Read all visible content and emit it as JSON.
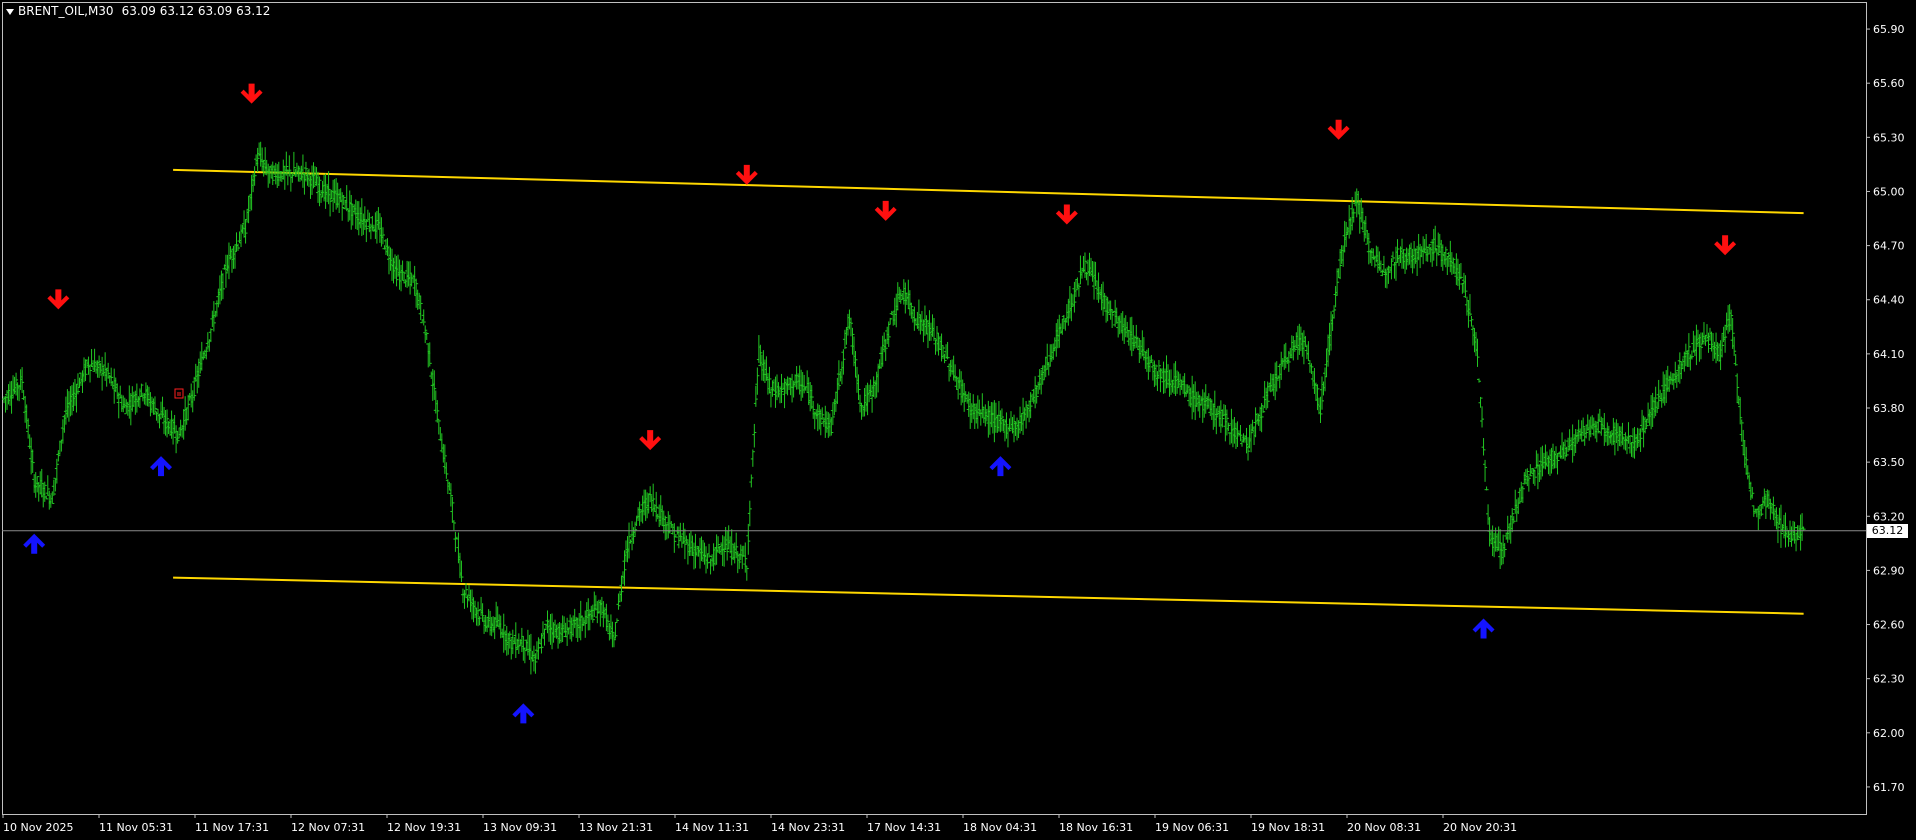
{
  "header": {
    "symbol": "BRENT_OIL,M30",
    "ohlc": "63.09 63.12 63.09 63.12"
  },
  "current_price_label": "63.12",
  "colors": {
    "background": "#000000",
    "frame": "#c0c0c0",
    "bars": "#22c522",
    "channel": "#ffd700",
    "signal_down": "#ff1010",
    "signal_up": "#1414ff",
    "price_line": "#8a8a8a",
    "text": "#ffffff"
  },
  "icons": {
    "dropdown": "triangle-down-icon",
    "sell_signal": "arrow-down-icon",
    "buy_signal": "arrow-up-icon",
    "object_marker": "small-square-icon"
  },
  "chart_data": {
    "type": "ohlc",
    "symbol": "BRENT_OIL",
    "timeframe": "M30",
    "ylim": [
      61.55,
      66.05
    ],
    "y_ticks": [
      "65.90",
      "65.60",
      "65.30",
      "65.00",
      "64.70",
      "64.40",
      "64.10",
      "63.80",
      "63.50",
      "63.20",
      "62.90",
      "62.60",
      "62.30",
      "62.00",
      "61.70"
    ],
    "x_ticks": [
      "10 Nov 2025",
      "11 Nov 05:31",
      "11 Nov 17:31",
      "12 Nov 07:31",
      "12 Nov 19:31",
      "13 Nov 09:31",
      "13 Nov 21:31",
      "14 Nov 11:31",
      "14 Nov 23:31",
      "17 Nov 14:31",
      "18 Nov 04:31",
      "18 Nov 16:31",
      "19 Nov 06:31",
      "19 Nov 18:31",
      "20 Nov 08:31",
      "20 Nov 20:31"
    ],
    "x_span_bars": 308,
    "current_price": 63.12,
    "price_path": [
      [
        0,
        63.85
      ],
      [
        3,
        63.95
      ],
      [
        5,
        63.4
      ],
      [
        8,
        63.3
      ],
      [
        10,
        63.75
      ],
      [
        14,
        64.05
      ],
      [
        17,
        64.0
      ],
      [
        20,
        63.8
      ],
      [
        23,
        63.9
      ],
      [
        26,
        63.75
      ],
      [
        29,
        63.65
      ],
      [
        31,
        63.85
      ],
      [
        34,
        64.2
      ],
      [
        37,
        64.6
      ],
      [
        40,
        64.8
      ],
      [
        42,
        65.2
      ],
      [
        44,
        65.1
      ],
      [
        47,
        65.1
      ],
      [
        50,
        65.1
      ],
      [
        53,
        65.0
      ],
      [
        56,
        64.95
      ],
      [
        59,
        64.85
      ],
      [
        62,
        64.8
      ],
      [
        65,
        64.55
      ],
      [
        68,
        64.5
      ],
      [
        70,
        64.2
      ],
      [
        72,
        63.7
      ],
      [
        74,
        63.3
      ],
      [
        76,
        62.8
      ],
      [
        78,
        62.7
      ],
      [
        80,
        62.6
      ],
      [
        82,
        62.6
      ],
      [
        84,
        62.5
      ],
      [
        86,
        62.5
      ],
      [
        88,
        62.4
      ],
      [
        90,
        62.6
      ],
      [
        92,
        62.55
      ],
      [
        95,
        62.6
      ],
      [
        97,
        62.65
      ],
      [
        99,
        62.7
      ],
      [
        101,
        62.5
      ],
      [
        103,
        63.0
      ],
      [
        105,
        63.2
      ],
      [
        107,
        63.3
      ],
      [
        109,
        63.2
      ],
      [
        111,
        63.1
      ],
      [
        113,
        63.05
      ],
      [
        115,
        63.0
      ],
      [
        117,
        62.95
      ],
      [
        119,
        63.05
      ],
      [
        121,
        63.0
      ],
      [
        123,
        62.95
      ],
      [
        125,
        64.1
      ],
      [
        127,
        63.9
      ],
      [
        129,
        63.9
      ],
      [
        131,
        63.95
      ],
      [
        133,
        63.9
      ],
      [
        135,
        63.75
      ],
      [
        137,
        63.7
      ],
      [
        140,
        64.3
      ],
      [
        142,
        63.8
      ],
      [
        144,
        63.9
      ],
      [
        147,
        64.3
      ],
      [
        149,
        64.45
      ],
      [
        151,
        64.3
      ],
      [
        153,
        64.25
      ],
      [
        155,
        64.15
      ],
      [
        160,
        63.8
      ],
      [
        163,
        63.75
      ],
      [
        166,
        63.7
      ],
      [
        168,
        63.7
      ],
      [
        171,
        63.9
      ],
      [
        174,
        64.15
      ],
      [
        177,
        64.4
      ],
      [
        179,
        64.6
      ],
      [
        182,
        64.4
      ],
      [
        185,
        64.25
      ],
      [
        188,
        64.15
      ],
      [
        191,
        64.0
      ],
      [
        194,
        63.95
      ],
      [
        197,
        63.85
      ],
      [
        200,
        63.8
      ],
      [
        203,
        63.7
      ],
      [
        206,
        63.6
      ],
      [
        209,
        63.85
      ],
      [
        212,
        64.05
      ],
      [
        215,
        64.2
      ],
      [
        218,
        63.8
      ],
      [
        220,
        64.3
      ],
      [
        222,
        64.75
      ],
      [
        224,
        64.95
      ],
      [
        226,
        64.7
      ],
      [
        228,
        64.55
      ],
      [
        231,
        64.65
      ],
      [
        234,
        64.65
      ],
      [
        237,
        64.7
      ],
      [
        240,
        64.6
      ],
      [
        242,
        64.45
      ],
      [
        244,
        64.1
      ],
      [
        246,
        63.1
      ],
      [
        248,
        63.0
      ],
      [
        250,
        63.2
      ],
      [
        252,
        63.4
      ],
      [
        255,
        63.5
      ],
      [
        258,
        63.55
      ],
      [
        261,
        63.65
      ],
      [
        264,
        63.7
      ],
      [
        267,
        63.65
      ],
      [
        270,
        63.6
      ],
      [
        273,
        63.8
      ],
      [
        276,
        63.95
      ],
      [
        279,
        64.1
      ],
      [
        282,
        64.2
      ],
      [
        284,
        64.1
      ],
      [
        286,
        64.3
      ],
      [
        288,
        63.6
      ],
      [
        290,
        63.2
      ],
      [
        292,
        63.3
      ],
      [
        294,
        63.15
      ],
      [
        296,
        63.1
      ],
      [
        298,
        63.1
      ]
    ],
    "channel_lines": [
      {
        "name": "upper",
        "from": [
          28,
          65.12
        ],
        "to": [
          298,
          64.88
        ]
      },
      {
        "name": "lower",
        "from": [
          28,
          62.86
        ],
        "to": [
          298,
          62.66
        ]
      }
    ],
    "signals": [
      {
        "dir": "up",
        "bar": 5,
        "price": 63.07
      },
      {
        "dir": "down",
        "bar": 9,
        "price": 64.38
      },
      {
        "dir": "up",
        "bar": 26,
        "price": 63.5
      },
      {
        "dir": "down",
        "bar": 41,
        "price": 65.52
      },
      {
        "dir": "up",
        "bar": 86,
        "price": 62.13
      },
      {
        "dir": "down",
        "bar": 107,
        "price": 63.6
      },
      {
        "dir": "down",
        "bar": 123,
        "price": 65.07
      },
      {
        "dir": "down",
        "bar": 146,
        "price": 64.87
      },
      {
        "dir": "up",
        "bar": 165,
        "price": 63.5
      },
      {
        "dir": "down",
        "bar": 176,
        "price": 64.85
      },
      {
        "dir": "down",
        "bar": 221,
        "price": 65.32
      },
      {
        "dir": "up",
        "bar": 245,
        "price": 62.6
      },
      {
        "dir": "down",
        "bar": 285,
        "price": 64.68
      }
    ]
  }
}
